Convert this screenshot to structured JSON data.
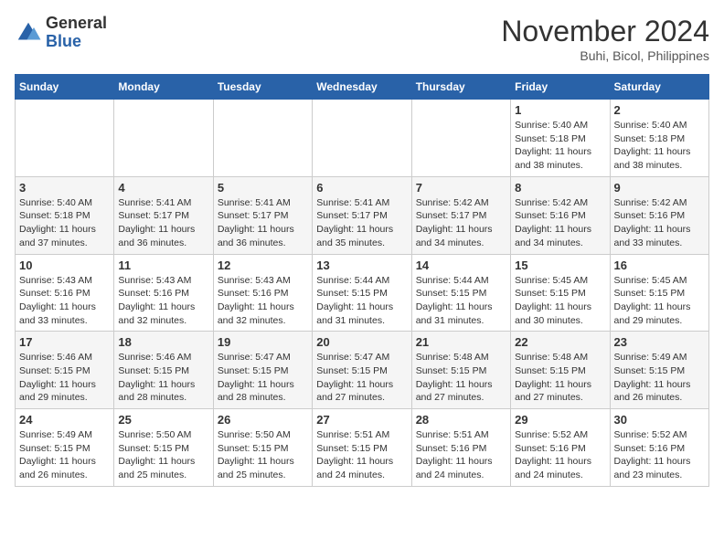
{
  "header": {
    "logo_line1": "General",
    "logo_line2": "Blue",
    "month": "November 2024",
    "location": "Buhi, Bicol, Philippines"
  },
  "weekdays": [
    "Sunday",
    "Monday",
    "Tuesday",
    "Wednesday",
    "Thursday",
    "Friday",
    "Saturday"
  ],
  "weeks": [
    [
      {
        "day": "",
        "info": ""
      },
      {
        "day": "",
        "info": ""
      },
      {
        "day": "",
        "info": ""
      },
      {
        "day": "",
        "info": ""
      },
      {
        "day": "",
        "info": ""
      },
      {
        "day": "1",
        "info": "Sunrise: 5:40 AM\nSunset: 5:18 PM\nDaylight: 11 hours and 38 minutes."
      },
      {
        "day": "2",
        "info": "Sunrise: 5:40 AM\nSunset: 5:18 PM\nDaylight: 11 hours and 38 minutes."
      }
    ],
    [
      {
        "day": "3",
        "info": "Sunrise: 5:40 AM\nSunset: 5:18 PM\nDaylight: 11 hours and 37 minutes."
      },
      {
        "day": "4",
        "info": "Sunrise: 5:41 AM\nSunset: 5:17 PM\nDaylight: 11 hours and 36 minutes."
      },
      {
        "day": "5",
        "info": "Sunrise: 5:41 AM\nSunset: 5:17 PM\nDaylight: 11 hours and 36 minutes."
      },
      {
        "day": "6",
        "info": "Sunrise: 5:41 AM\nSunset: 5:17 PM\nDaylight: 11 hours and 35 minutes."
      },
      {
        "day": "7",
        "info": "Sunrise: 5:42 AM\nSunset: 5:17 PM\nDaylight: 11 hours and 34 minutes."
      },
      {
        "day": "8",
        "info": "Sunrise: 5:42 AM\nSunset: 5:16 PM\nDaylight: 11 hours and 34 minutes."
      },
      {
        "day": "9",
        "info": "Sunrise: 5:42 AM\nSunset: 5:16 PM\nDaylight: 11 hours and 33 minutes."
      }
    ],
    [
      {
        "day": "10",
        "info": "Sunrise: 5:43 AM\nSunset: 5:16 PM\nDaylight: 11 hours and 33 minutes."
      },
      {
        "day": "11",
        "info": "Sunrise: 5:43 AM\nSunset: 5:16 PM\nDaylight: 11 hours and 32 minutes."
      },
      {
        "day": "12",
        "info": "Sunrise: 5:43 AM\nSunset: 5:16 PM\nDaylight: 11 hours and 32 minutes."
      },
      {
        "day": "13",
        "info": "Sunrise: 5:44 AM\nSunset: 5:15 PM\nDaylight: 11 hours and 31 minutes."
      },
      {
        "day": "14",
        "info": "Sunrise: 5:44 AM\nSunset: 5:15 PM\nDaylight: 11 hours and 31 minutes."
      },
      {
        "day": "15",
        "info": "Sunrise: 5:45 AM\nSunset: 5:15 PM\nDaylight: 11 hours and 30 minutes."
      },
      {
        "day": "16",
        "info": "Sunrise: 5:45 AM\nSunset: 5:15 PM\nDaylight: 11 hours and 29 minutes."
      }
    ],
    [
      {
        "day": "17",
        "info": "Sunrise: 5:46 AM\nSunset: 5:15 PM\nDaylight: 11 hours and 29 minutes."
      },
      {
        "day": "18",
        "info": "Sunrise: 5:46 AM\nSunset: 5:15 PM\nDaylight: 11 hours and 28 minutes."
      },
      {
        "day": "19",
        "info": "Sunrise: 5:47 AM\nSunset: 5:15 PM\nDaylight: 11 hours and 28 minutes."
      },
      {
        "day": "20",
        "info": "Sunrise: 5:47 AM\nSunset: 5:15 PM\nDaylight: 11 hours and 27 minutes."
      },
      {
        "day": "21",
        "info": "Sunrise: 5:48 AM\nSunset: 5:15 PM\nDaylight: 11 hours and 27 minutes."
      },
      {
        "day": "22",
        "info": "Sunrise: 5:48 AM\nSunset: 5:15 PM\nDaylight: 11 hours and 27 minutes."
      },
      {
        "day": "23",
        "info": "Sunrise: 5:49 AM\nSunset: 5:15 PM\nDaylight: 11 hours and 26 minutes."
      }
    ],
    [
      {
        "day": "24",
        "info": "Sunrise: 5:49 AM\nSunset: 5:15 PM\nDaylight: 11 hours and 26 minutes."
      },
      {
        "day": "25",
        "info": "Sunrise: 5:50 AM\nSunset: 5:15 PM\nDaylight: 11 hours and 25 minutes."
      },
      {
        "day": "26",
        "info": "Sunrise: 5:50 AM\nSunset: 5:15 PM\nDaylight: 11 hours and 25 minutes."
      },
      {
        "day": "27",
        "info": "Sunrise: 5:51 AM\nSunset: 5:15 PM\nDaylight: 11 hours and 24 minutes."
      },
      {
        "day": "28",
        "info": "Sunrise: 5:51 AM\nSunset: 5:16 PM\nDaylight: 11 hours and 24 minutes."
      },
      {
        "day": "29",
        "info": "Sunrise: 5:52 AM\nSunset: 5:16 PM\nDaylight: 11 hours and 24 minutes."
      },
      {
        "day": "30",
        "info": "Sunrise: 5:52 AM\nSunset: 5:16 PM\nDaylight: 11 hours and 23 minutes."
      }
    ]
  ]
}
